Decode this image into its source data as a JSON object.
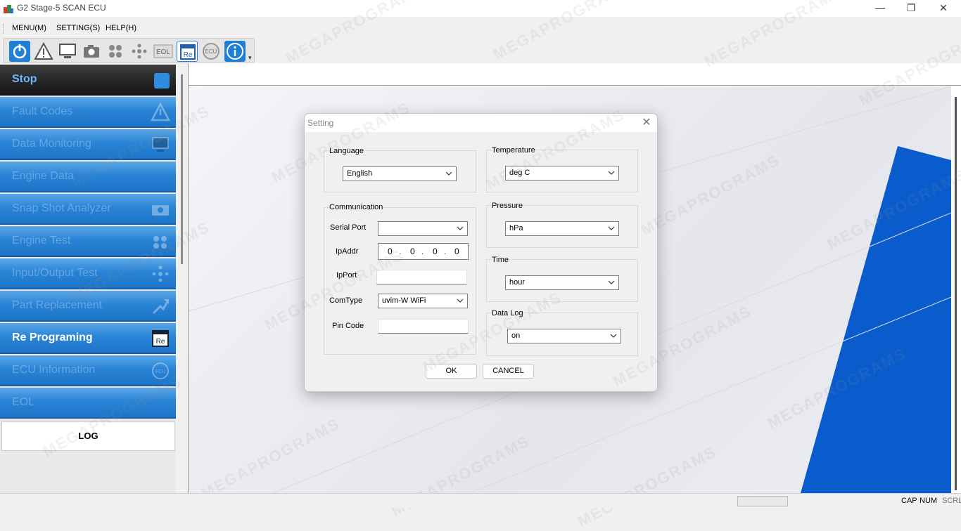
{
  "window": {
    "title": "G2 Stage-5 SCAN ECU",
    "controls": {
      "minimize": "—",
      "maximize": "❐",
      "close": "✕"
    }
  },
  "menu": [
    "MENU(M)",
    "SETTING(S)",
    "HELP(H)"
  ],
  "toolbar": {
    "buttons": [
      "power-icon",
      "warning-icon",
      "monitor-icon",
      "camera-icon",
      "engine-test-icon",
      "io-test-icon",
      "eol-icon",
      "reprogram-icon",
      "ecu-icon",
      "info-icon"
    ],
    "eol_text": "EOL",
    "re_text": "Re",
    "ecu_text": "ECU",
    "more": "▾"
  },
  "sidebar": {
    "stop": "Stop",
    "items": [
      {
        "label": "Fault Codes",
        "icon": "warning-icon",
        "active": false
      },
      {
        "label": "Data Monitoring",
        "icon": "monitor-icon",
        "active": false
      },
      {
        "label": "Engine Data",
        "icon": "",
        "active": false
      },
      {
        "label": "Snap Shot Analyzer",
        "icon": "camera-icon",
        "active": false
      },
      {
        "label": "Engine Test",
        "icon": "engine-test-icon",
        "active": false
      },
      {
        "label": "Input/Output Test",
        "icon": "io-test-icon",
        "active": false
      },
      {
        "label": "Part Replacement",
        "icon": "part-replacement-icon",
        "active": false
      },
      {
        "label": "Re Programing",
        "icon": "reprogram-icon",
        "active": true
      },
      {
        "label": "ECU Information",
        "icon": "ecu-icon",
        "active": false
      },
      {
        "label": "EOL",
        "icon": "",
        "active": false
      }
    ],
    "log": "LOG"
  },
  "dialog": {
    "title": "Setting",
    "close": "✕",
    "language": {
      "label": "Language",
      "value": "English"
    },
    "communication": {
      "label": "Communication",
      "serial_port": {
        "label": "Serial Port",
        "value": ""
      },
      "ipaddr": {
        "label": "IpAddr",
        "octets": [
          "0",
          "0",
          "0",
          "0"
        ]
      },
      "ipport": {
        "label": "IpPort",
        "value": ""
      },
      "comtype": {
        "label": "ComType",
        "value": "uvim-W WiFi"
      },
      "pin_code": {
        "label": "Pin Code",
        "value": ""
      }
    },
    "temperature": {
      "label": "Temperature",
      "value": "deg C"
    },
    "pressure": {
      "label": "Pressure",
      "value": "hPa"
    },
    "time": {
      "label": "Time",
      "value": "hour"
    },
    "data_log": {
      "label": "Data Log",
      "value": "on"
    },
    "ok": "OK",
    "cancel": "CANCEL"
  },
  "statusbar": {
    "cap": "CAP",
    "num": "NUM",
    "scrl": "SCRL"
  },
  "watermark": "MEGAPROGRAMS",
  "colors": {
    "accent": "#1d74c8",
    "brand_blue": "#0a5ccc",
    "stop_bar": "#1a1a1a"
  }
}
